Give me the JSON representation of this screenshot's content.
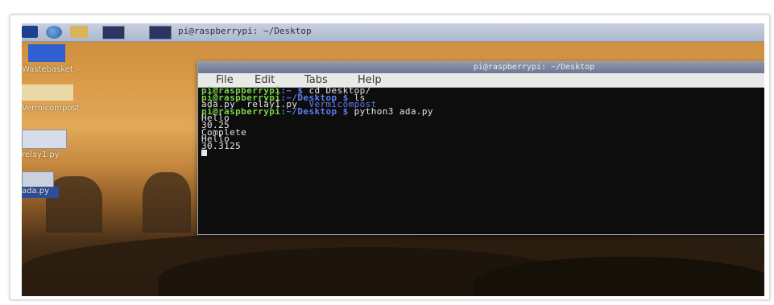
{
  "taskbar": {
    "active_task_label": "pi@raspberrypi: ~/Desktop"
  },
  "desktop": {
    "icons": [
      {
        "label": "Wastebasket"
      },
      {
        "label": "Vermicompost"
      },
      {
        "label": "relay1.py"
      },
      {
        "label": "ada.py"
      }
    ]
  },
  "terminal": {
    "title": "pi@raspberrypi: ~/Desktop",
    "menu": [
      "File",
      "Edit",
      "Tabs",
      "Help"
    ],
    "prompt_user": "pi@raspberrypi",
    "lines": [
      {
        "path": "~",
        "command": "cd Desktop/"
      },
      {
        "path": "~/Desktop",
        "command": "ls"
      },
      {
        "files": [
          "ada.py",
          "relay1.py"
        ],
        "dirs": [
          "Vermicompost"
        ]
      },
      {
        "path": "~/Desktop",
        "command": "python3 ada.py"
      },
      {
        "output": "Hello"
      },
      {
        "output": "30.25"
      },
      {
        "output": "Complete"
      },
      {
        "output": "Hello"
      },
      {
        "output": "30.3125"
      }
    ]
  },
  "colors": {
    "prompt_green": "#7ad24a",
    "path_blue": "#5d7cf0",
    "terminal_bg": "#0c0d0c",
    "taskbar": "#aeb8cd"
  },
  "icons": {
    "menu": "raspberry-menu-icon",
    "web": "web-browser-icon",
    "files": "file-manager-icon",
    "terminal": "terminal-icon",
    "trash": "wastebasket-icon",
    "folder": "folder-icon",
    "python_file": "python-file-icon"
  }
}
